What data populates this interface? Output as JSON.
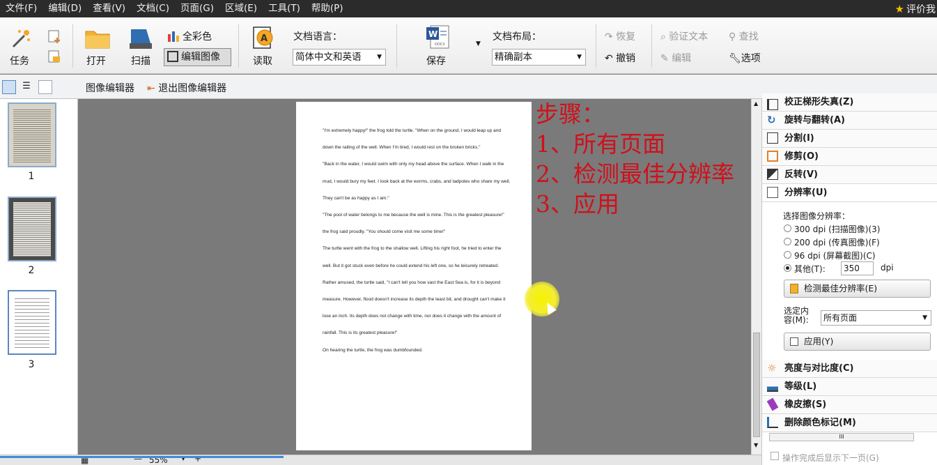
{
  "menu": [
    "文件(F)",
    "编辑(D)",
    "查看(V)",
    "文档(C)",
    "页面(G)",
    "区域(E)",
    "工具(T)",
    "帮助(P)"
  ],
  "rate_label": "评价我",
  "ribbon": {
    "task": "任务",
    "open": "打开",
    "scan": "扫描",
    "full_color": "全彩色",
    "edit_image": "编辑图像",
    "read": "读取",
    "doc_lang_label": "文档语言：",
    "doc_lang_value": "简体中文和英语",
    "save": "保存",
    "doc_layout_label": "文档布局：",
    "doc_layout_value": "精确副本",
    "redo": "恢复",
    "undo": "撤销",
    "verify_text": "验证文本",
    "edit": "编辑",
    "find": "查找",
    "options": "选项"
  },
  "toolbar2": {
    "image_editor": "图像编辑器",
    "exit_editor": "退出图像编辑器"
  },
  "thumbnails": [
    {
      "num": "1"
    },
    {
      "num": "2"
    },
    {
      "num": "3"
    }
  ],
  "page_paragraphs": [
    "\"I'm extremely happy!\" the frog told the turtle. \"When on the ground, I would leap up and down the railing of the well. When I'm tired, I would rest on the broken bricks.\"",
    "\"Back in the water, I would swim with only my head above the surface. When I walk in the mud, I would bury my feet. I look back at the worms, crabs, and tadpoles who share my well. They can't be as happy as I am.\"",
    "\"The pool of water belongs to me because the well is mine. This is the greatest pleasure!\" the frog said proudly. \"You should come visit me some time!\"",
    "The turtle went with the frog to the shallow well. Lifting his right foot, he tried to enter the well. But it got stuck even before he could extend his left one, so he leisurely retreated.",
    "Rather amused, the turtle said, \"I can't tell you how vast the East Sea is, for it is beyond measure. However, flood doesn't increase its depth the least bit, and drought can't make it lose an inch. Its depth does not change with time, nor does it change with the amount of rainfall. This is its greatest pleasure!\"",
    "On hearing the turtle, the frog was dumbfounded."
  ],
  "annotation": [
    "步骤：",
    "1、所有页面",
    "2、检测最佳分辨率",
    "3、应用"
  ],
  "right_panel": {
    "sections_top": [
      "校正梯形失真(Z)",
      "旋转与翻转(A)",
      "分割(I)",
      "修剪(O)",
      "反转(V)",
      "分辨率(U)"
    ],
    "choose_res_label": "选择图像分辨率：",
    "res_options": [
      "300 dpi (扫描图像)(3)",
      "200 dpi (传真图像)(F)",
      "96 dpi (屏幕截图)(C)"
    ],
    "other_label": "其他(T):",
    "other_value": "350",
    "dpi_unit": "dpi",
    "detect_button": "检测最佳分辨率(E)",
    "selected_content_label": "选定内容(M):",
    "selected_content_value": "所有页面",
    "apply_button": "应用(Y)",
    "sections_bottom": [
      "亮度与对比度(C)",
      "等级(L)",
      "橡皮擦(S)",
      "删除颜色标记(M)"
    ],
    "footer_check": "操作完成后显示下一页(G)"
  },
  "zoom_value": "55%",
  "colors": {
    "annotation": "#d0101a",
    "highlight": "#f7f200",
    "progress": "#3c8be0"
  }
}
